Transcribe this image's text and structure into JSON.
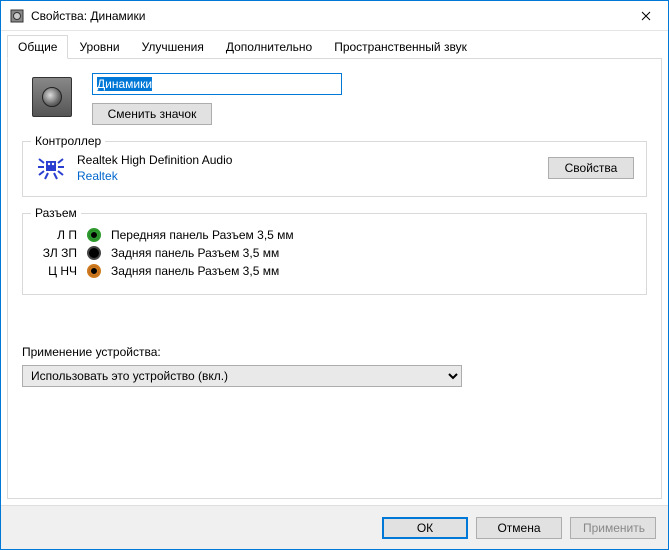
{
  "window": {
    "title": "Свойства: Динамики"
  },
  "tabs": {
    "items": [
      {
        "label": "Общие"
      },
      {
        "label": "Уровни"
      },
      {
        "label": "Улучшения"
      },
      {
        "label": "Дополнительно"
      },
      {
        "label": "Пространственный звук"
      }
    ],
    "active_index": 0
  },
  "device": {
    "name": "Динамики",
    "change_icon_label": "Сменить значок"
  },
  "controller": {
    "legend": "Контроллер",
    "name": "Realtek High Definition Audio",
    "vendor": "Realtek",
    "properties_button": "Свойства"
  },
  "jacks": {
    "legend": "Разъем",
    "items": [
      {
        "label": "Л П",
        "color": "green",
        "desc": "Передняя панель Разъем 3,5 мм"
      },
      {
        "label": "ЗЛ ЗП",
        "color": "black",
        "desc": "Задняя панель Разъем 3,5 мм"
      },
      {
        "label": "Ц НЧ",
        "color": "orange",
        "desc": "Задняя панель Разъем 3,5 мм"
      }
    ]
  },
  "usage": {
    "label": "Применение устройства:",
    "selected": "Использовать это устройство (вкл.)"
  },
  "footer": {
    "ok": "ОК",
    "cancel": "Отмена",
    "apply": "Применить"
  }
}
